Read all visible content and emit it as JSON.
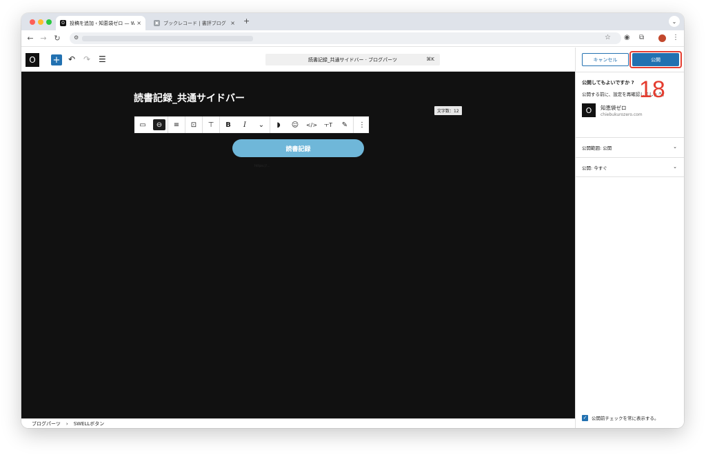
{
  "browser": {
    "tabs": [
      {
        "title": "投稿を追加 ‹ 知恵袋ゼロ — Wor",
        "favicon": "O"
      },
      {
        "title": "ブックレコード | 書評ブログ",
        "favicon": "▣"
      }
    ],
    "close_glyph": "×",
    "new_tab_glyph": "+",
    "tab_menu_glyph": "⌄",
    "nav": {
      "back": "←",
      "forward": "→",
      "reload": "↻",
      "site_info": "⚙",
      "star": "☆",
      "ext1": "◉",
      "ext2": "⧉",
      "menu": "⋮"
    }
  },
  "editor_header": {
    "logo": "O",
    "inserter": "+",
    "undo": "↶",
    "redo": "↷",
    "list_view": "☰",
    "command_bar": "読書記録_共通サイドバー · ブログパーツ",
    "shortcut": "⌘K"
  },
  "canvas": {
    "post_title": "読書記録_共通サイドバー",
    "word_count": "文字数：12",
    "button_label": "読書記録",
    "button_url_hint": "https://..."
  },
  "toolbar": {
    "glyphs": [
      "▭",
      "⊖",
      "≡",
      "⊡",
      "⊤",
      "B",
      "I",
      "⌄",
      "◗",
      "☺",
      "</>",
      "ㅜT",
      "✎",
      "⋮"
    ]
  },
  "sidebar": {
    "cancel": "キャンセル",
    "publish": "公開",
    "step_number": "18",
    "confirm_head": "公開してもよいですか ?",
    "confirm_sub": "公開する前に、設定を再確認しましょう。",
    "site_logo": "O",
    "site_name": "知恵袋ゼロ",
    "site_url": "chiebukurozero.com",
    "panels": [
      {
        "label": "公開範囲: 公開",
        "chevron": "⌄"
      },
      {
        "label": "公開: 今すぐ",
        "chevron": "⌄"
      }
    ],
    "always_show_label": "公開前チェックを常に表示する。",
    "check_glyph": "✓"
  },
  "breadcrumb": {
    "items": [
      "ブログパーツ",
      "SWELLボタン"
    ],
    "separator": "›"
  },
  "colors": {
    "accent": "#2271b1",
    "canvas_bg": "#111111",
    "button_bg": "#6fb7d9",
    "annotation": "#e43c2f"
  }
}
